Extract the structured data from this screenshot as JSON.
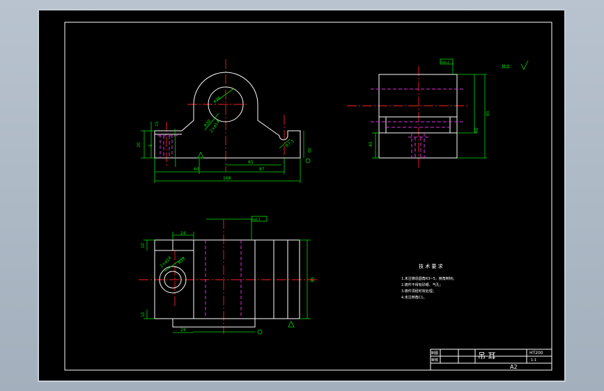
{
  "views": {
    "front": {
      "dims": {
        "d_top": "15",
        "d_left1": "5",
        "d_left2": "20",
        "d_60": "60",
        "d_65": "65",
        "d_87": "87",
        "d_168": "168",
        "d_30": "30",
        "d_dia": "ø35",
        "d_r": "R30",
        "d_hole": "2×ø14",
        "d_rr": "R7.5"
      }
    },
    "side": {
      "dims": {
        "d_95": "95",
        "d_60": "60",
        "d_45": "45"
      },
      "datum_tag": "Ra6.3",
      "roughness_note": "其余："
    },
    "top": {
      "dims": {
        "d_24a": "24",
        "d_24b": "24",
        "d_10a": "10",
        "d_10b": "10",
        "d_58": "58",
        "d_hole": "2×ø14",
        "d_r": "R12"
      },
      "datum_tag": "Ra6.3"
    }
  },
  "tech": {
    "title": "技 术 要 求",
    "items": [
      "1.未注铸造圆角R3~5，棱角倒钝；",
      "2.铸件不得有砂眼、气孔；",
      "3.铸件须经时效处理；",
      "4.未注倒角C1。"
    ]
  },
  "title_block": {
    "part_name": "吊  耳",
    "material": "HT200",
    "scale": "1:1",
    "sheet_size": "A2",
    "row_labels": [
      "制图",
      "审核"
    ]
  },
  "colors": {
    "outline": "#ffffff",
    "dimension": "#00e000",
    "centerline": "#ff2020",
    "hidden": "#e030e0"
  }
}
